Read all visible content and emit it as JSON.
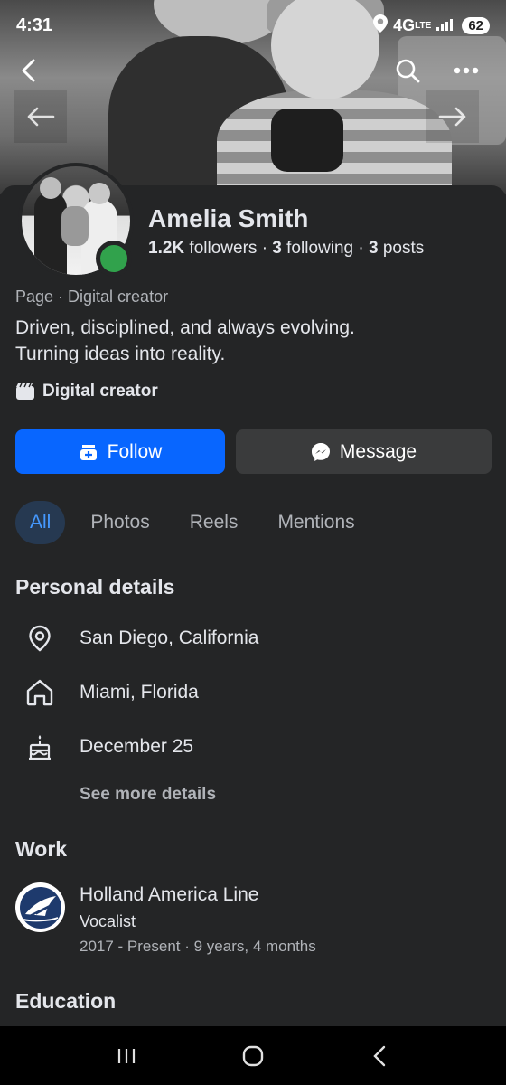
{
  "status_bar": {
    "time": "4:31",
    "network": "4G",
    "network_sub": "LTE",
    "battery": "62"
  },
  "profile": {
    "name": "Amelia Smith",
    "followers_count": "1.2K",
    "followers_label": "followers",
    "following_count": "3",
    "following_label": "following",
    "posts_count": "3",
    "posts_label": "posts",
    "separator": "·",
    "page_type": "Page · Digital creator",
    "bio_line1": "Driven, disciplined, and always evolving.",
    "bio_line2": "Turning ideas into reality.",
    "category": "Digital creator"
  },
  "actions": {
    "follow": "Follow",
    "message": "Message"
  },
  "tabs": [
    {
      "label": "All",
      "active": true
    },
    {
      "label": "Photos",
      "active": false
    },
    {
      "label": "Reels",
      "active": false
    },
    {
      "label": "Mentions",
      "active": false
    }
  ],
  "personal_details": {
    "title": "Personal details",
    "items": [
      {
        "icon": "location-pin-icon",
        "text": "San Diego, California"
      },
      {
        "icon": "home-icon",
        "text": "Miami, Florida"
      },
      {
        "icon": "birthday-cake-icon",
        "text": "December 25"
      }
    ],
    "see_more": "See more details"
  },
  "work": {
    "title": "Work",
    "company": "Holland America Line",
    "role": "Vocalist",
    "dates": "2017 - Present · 9 years, 4 months"
  },
  "education": {
    "title": "Education"
  },
  "colors": {
    "background": "#242526",
    "primary_button": "#0866ff",
    "secondary_button": "#3a3b3c",
    "active_tab_bg": "#263951",
    "active_tab_text": "#4599ff",
    "online": "#31a24c"
  }
}
